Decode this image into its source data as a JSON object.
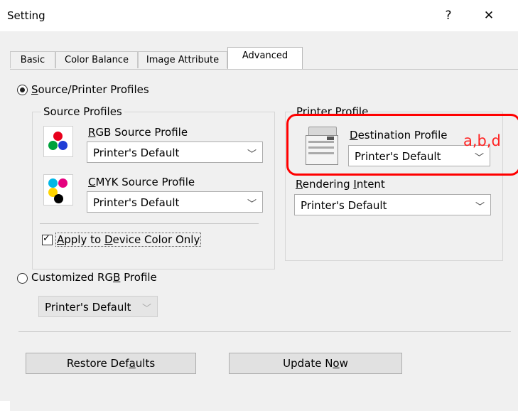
{
  "window": {
    "title": "Setting",
    "help_label": "?",
    "close_label": "✕"
  },
  "tabs": [
    "Basic",
    "Color Balance",
    "Image Attribute",
    "Advanced"
  ],
  "source_printer_profiles": {
    "label": "Source/Printer Profiles",
    "selected": true,
    "source_profiles": {
      "group_label": "Source Profiles",
      "rgb_label": "RGB Source Profile",
      "rgb_value": "Printer's Default",
      "cmyk_label": "CMYK Source Profile",
      "cmyk_value": "Printer's Default",
      "apply_checkbox_label": "Apply to Device Color Only",
      "apply_checked": true
    },
    "printer_profile": {
      "group_label": "Printer Profile",
      "destination_label": "Destination Profile",
      "destination_value": "Printer's Default",
      "rendering_label": "Rendering Intent",
      "rendering_value": "Printer's Default"
    }
  },
  "customized_rgb": {
    "label": "Customized RGB Profile",
    "selected": false,
    "value": "Printer's Default"
  },
  "buttons": {
    "restore_defaults": "Restore Defaults",
    "update_now": "Update Now"
  },
  "annotation": {
    "text": "a,b,d",
    "color": "#ff0000"
  },
  "icon_colors": {
    "rgb_dots": [
      "#e8001c",
      "#00a23c",
      "#1f3dd6"
    ],
    "cmyk_dots": [
      "#00b7e6",
      "#e5007e",
      "#ffd400",
      "#000000"
    ]
  }
}
